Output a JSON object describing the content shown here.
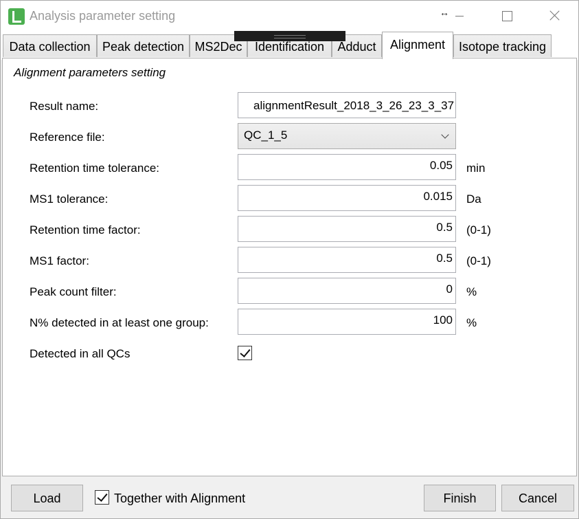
{
  "window": {
    "title": "Analysis parameter setting",
    "resize_glyph": "↔"
  },
  "tabs": [
    {
      "label": "Data collection",
      "active": false
    },
    {
      "label": "Peak detection",
      "active": false
    },
    {
      "label": "MS2Dec",
      "active": false
    },
    {
      "label": "Identification",
      "active": false
    },
    {
      "label": "Adduct",
      "active": false
    },
    {
      "label": "Alignment",
      "active": true
    },
    {
      "label": "Isotope tracking",
      "active": false
    }
  ],
  "section_title": "Alignment parameters setting",
  "fields": {
    "result_name": {
      "label": "Result name:",
      "value": "alignmentResult_2018_3_26_23_3_37"
    },
    "reference_file": {
      "label": "Reference file:",
      "value": "QC_1_5"
    },
    "rt_tolerance": {
      "label": "Retention time tolerance:",
      "value": "0.05",
      "unit": "min"
    },
    "ms1_tolerance": {
      "label": "MS1 tolerance:",
      "value": "0.015",
      "unit": "Da"
    },
    "rt_factor": {
      "label": "Retention time factor:",
      "value": "0.5",
      "unit": "(0-1)"
    },
    "ms1_factor": {
      "label": "MS1 factor:",
      "value": "0.5",
      "unit": "(0-1)"
    },
    "peak_count_filter": {
      "label": "Peak count filter:",
      "value": "0",
      "unit": "%"
    },
    "n_percent_detected": {
      "label": "N% detected in at least one group:",
      "value": "100",
      "unit": "%"
    },
    "detected_in_all_qcs": {
      "label": "Detected in all QCs",
      "checked": true
    }
  },
  "footer": {
    "load_label": "Load",
    "together_label": "Together with Alignment",
    "together_checked": true,
    "finish_label": "Finish",
    "cancel_label": "Cancel"
  }
}
